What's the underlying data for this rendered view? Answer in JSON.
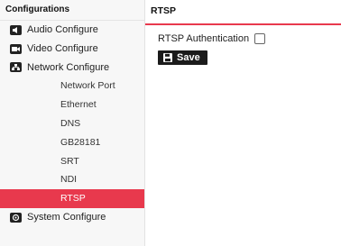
{
  "sidebar": {
    "header": "Configurations",
    "items": [
      {
        "label": "Audio Configure",
        "icon": "speaker-icon"
      },
      {
        "label": "Video Configure",
        "icon": "camera-icon"
      },
      {
        "label": "Network Configure",
        "icon": "network-icon"
      }
    ],
    "subitems": [
      {
        "label": "Network Port"
      },
      {
        "label": "Ethernet"
      },
      {
        "label": "DNS"
      },
      {
        "label": "GB28181"
      },
      {
        "label": "SRT"
      },
      {
        "label": "NDI"
      },
      {
        "label": "RTSP",
        "active": true
      }
    ],
    "bottom_item": {
      "label": "System Configure",
      "icon": "system-icon"
    }
  },
  "main": {
    "title": "RTSP",
    "auth_label": "RTSP Authentication",
    "auth_checked": false,
    "save_label": "Save"
  },
  "colors": {
    "accent": "#e8394d",
    "button": "#1b1b1b"
  }
}
